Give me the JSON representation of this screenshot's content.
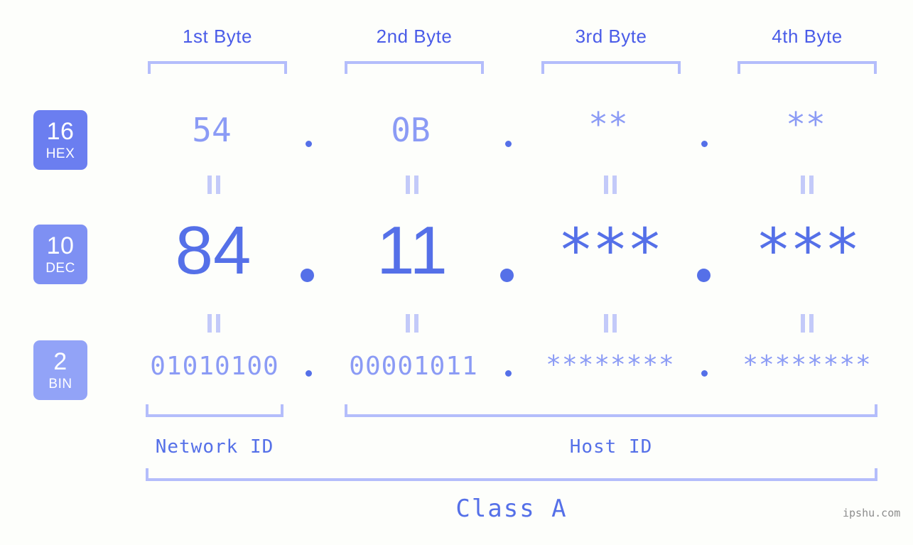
{
  "background_color": "#fdfefb",
  "accent_color": "#5570e8",
  "accent_light": "#8b9bf5",
  "bracket_color": "#b4bdfb",
  "byte_headers": [
    {
      "label": "1st Byte"
    },
    {
      "label": "2nd Byte"
    },
    {
      "label": "3rd Byte"
    },
    {
      "label": "4th Byte"
    }
  ],
  "bases": [
    {
      "number": "16",
      "name": "HEX",
      "color": "#6b7ef0"
    },
    {
      "number": "10",
      "name": "DEC",
      "color": "#7e90f3"
    },
    {
      "number": "2",
      "name": "BIN",
      "color": "#92a3f7"
    }
  ],
  "rows": {
    "hex": {
      "values": [
        "54",
        "0B",
        "**",
        "**"
      ],
      "separator": "."
    },
    "dec": {
      "values": [
        "84",
        "11",
        "***",
        "***"
      ],
      "separator": "."
    },
    "bin": {
      "values": [
        "01010100",
        "00001011",
        "********",
        "********"
      ],
      "separator": "."
    }
  },
  "equals_symbol": "=",
  "sections": [
    {
      "label": "Network ID"
    },
    {
      "label": "Host ID"
    }
  ],
  "class_label": "Class A",
  "watermark": "ipshu.com"
}
